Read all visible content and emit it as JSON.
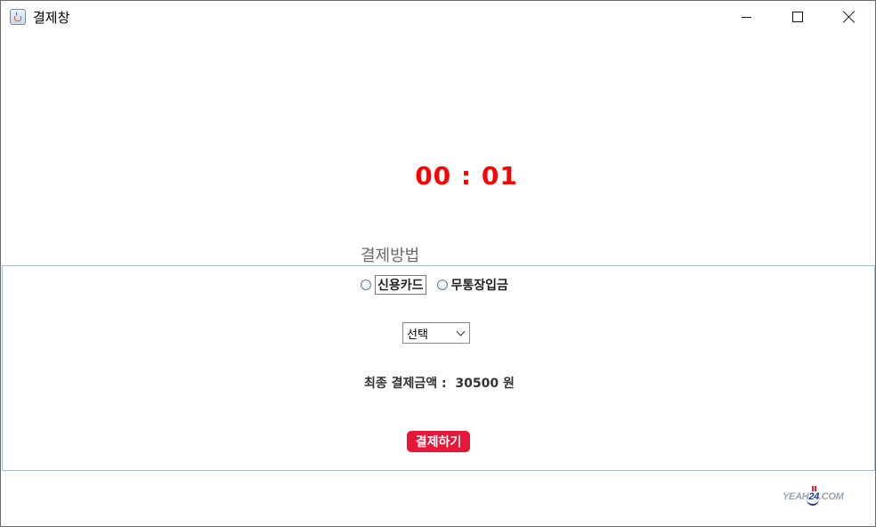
{
  "window": {
    "title": "결제창",
    "controls": {
      "minimize": "minimize-icon",
      "maximize": "maximize-icon",
      "close": "close-icon"
    }
  },
  "timer": {
    "text": "00 : 01",
    "color": "#ff0000"
  },
  "payment": {
    "section_title": "결제방법",
    "options": [
      {
        "label": "신용카드",
        "selected": false,
        "focused": true
      },
      {
        "label": "무통장입금",
        "selected": false,
        "focused": false
      }
    ],
    "select": {
      "value": "선택"
    },
    "total": {
      "text": "최종 결제금액 :  30500 원"
    },
    "submit_label": "결제하기",
    "submit_color": "#e8173a"
  },
  "logo": {
    "prefix": "YEAH",
    "number": "24",
    "suffix": ".COM"
  }
}
